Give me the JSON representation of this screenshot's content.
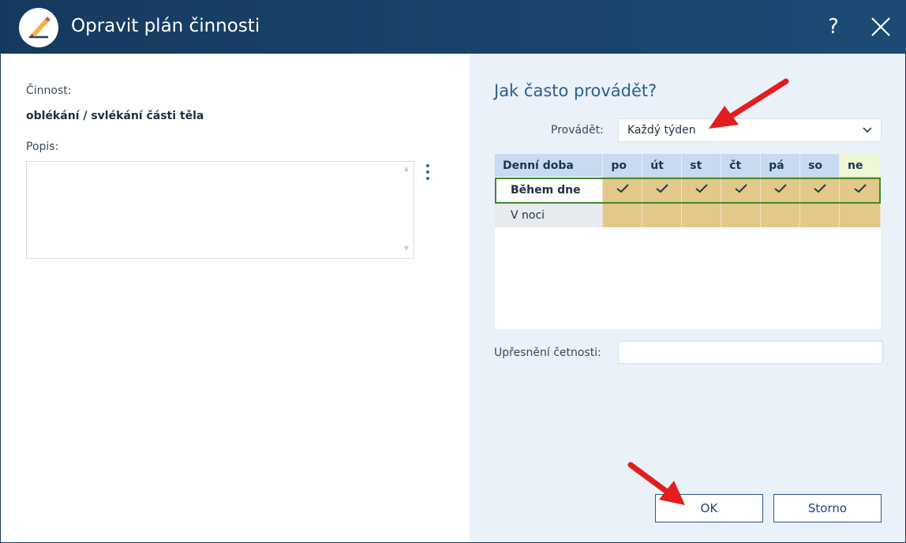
{
  "window": {
    "title": "Opravit plán činnosti",
    "help_label": "?",
    "icon": "pencil-icon",
    "colors": {
      "titlebar": "#1c4a75",
      "accent": "#2a6090",
      "highlight_cells": "#e3c889",
      "selected_row_border": "#3f8a2e",
      "annotation_arrow": "#e21d1d"
    }
  },
  "left": {
    "activity_label": "Činnost:",
    "activity_value": "oblékání / svlékání části těla",
    "description_label": "Popis:",
    "description_value": ""
  },
  "right": {
    "section_title": "Jak často provádět?",
    "perform_label": "Provádět:",
    "perform_value": "Každý týden",
    "schedule": {
      "header_first": "Denní doba",
      "days": [
        "po",
        "út",
        "st",
        "čt",
        "pá",
        "so",
        "ne"
      ],
      "rows": [
        {
          "label": "Během dne",
          "checked": [
            true,
            true,
            true,
            true,
            true,
            true,
            true
          ],
          "selected": true
        },
        {
          "label": "V noci",
          "checked": [
            false,
            false,
            false,
            false,
            false,
            false,
            false
          ],
          "selected": false
        }
      ]
    },
    "frequency_label": "Upřesnění četnosti:",
    "frequency_value": ""
  },
  "buttons": {
    "ok": "OK",
    "cancel": "Storno"
  }
}
